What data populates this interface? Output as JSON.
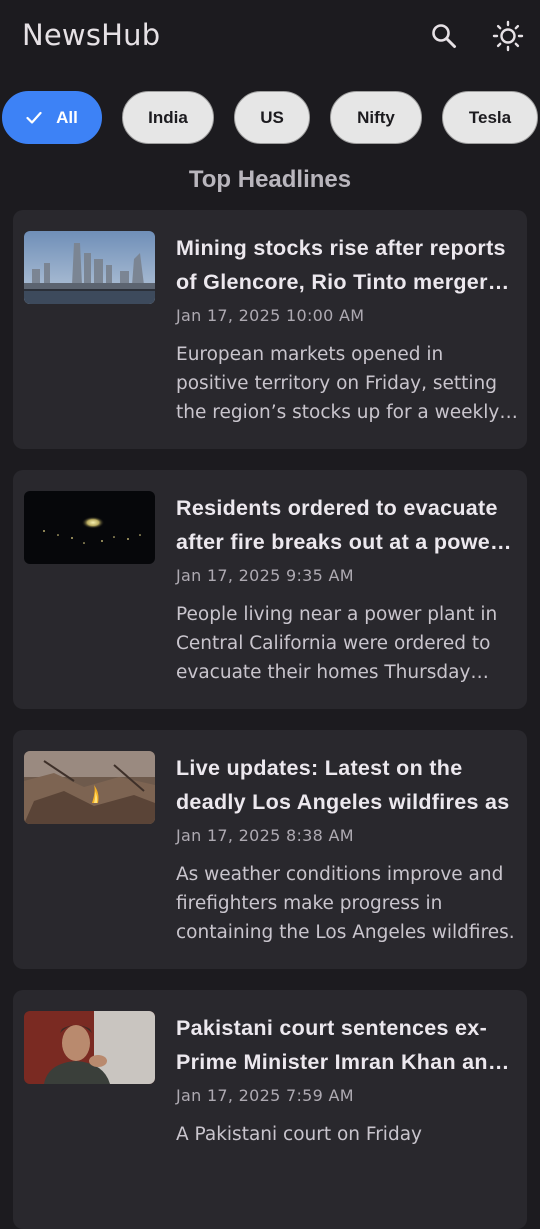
{
  "app_bar": {
    "title": "NewsHub",
    "search_icon": "search-icon",
    "theme_icon": "sun-icon"
  },
  "filters": [
    {
      "label": "All",
      "selected": true
    },
    {
      "label": "India",
      "selected": false
    },
    {
      "label": "US",
      "selected": false
    },
    {
      "label": "Nifty",
      "selected": false
    },
    {
      "label": "Tesla",
      "selected": false
    }
  ],
  "section_title": "Top Headlines",
  "articles": [
    {
      "title": "Mining stocks rise after reports of Glencore, Rio Tinto merger talks",
      "date": "Jan 17, 2025 10:00 AM",
      "description": "European markets opened in positive territory on Friday, setting the region’s stocks up for a weekly gain.",
      "image": "city-skyline-image"
    },
    {
      "title": "Residents ordered to evacuate after fire breaks out at a power plant",
      "date": "Jan 17, 2025 9:35 AM",
      "description": "People living near a power plant in Central California were ordered to evacuate their homes Thursday night.",
      "image": "night-fire-image"
    },
    {
      "title": "Live updates: Latest on the deadly Los Angeles wildfires as",
      "date": "Jan 17, 2025 8:38 AM",
      "description": "As weather conditions improve and firefighters make progress in containing the Los Angeles wildfires.",
      "image": "wildfire-ruins-image"
    },
    {
      "title": "Pakistani court sentences ex-Prime Minister Imran Khan and his wife",
      "date": "Jan 17, 2025 7:59 AM",
      "description": "A Pakistani court on Friday",
      "image": "portrait-image"
    }
  ]
}
